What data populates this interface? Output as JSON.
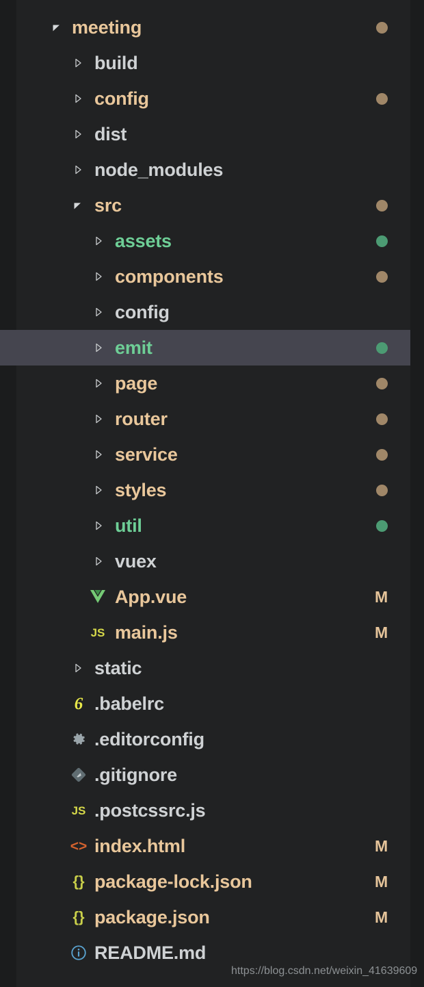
{
  "explorer": {
    "watermark": "https://blog.csdn.net/weixin_41639609",
    "colors": {
      "background": "#212223",
      "selected_row": "#45454f",
      "text_modified": "#e9c79b",
      "text_untracked": "#6ece96",
      "text_default": "#cfd2d4",
      "dot_modified": "#a08768",
      "dot_untracked": "#4c9b73"
    },
    "rows": [
      {
        "label": "meeting",
        "indent": 0,
        "type": "folder",
        "state": "expanded",
        "color": "tan",
        "badge": "dot-tan",
        "icon": ""
      },
      {
        "label": "build",
        "indent": 1,
        "type": "folder",
        "state": "collapsed",
        "color": "gray",
        "badge": "",
        "icon": ""
      },
      {
        "label": "config",
        "indent": 1,
        "type": "folder",
        "state": "collapsed",
        "color": "tan",
        "badge": "dot-tan",
        "icon": ""
      },
      {
        "label": "dist",
        "indent": 1,
        "type": "folder",
        "state": "collapsed",
        "color": "gray",
        "badge": "",
        "icon": ""
      },
      {
        "label": "node_modules",
        "indent": 1,
        "type": "folder",
        "state": "collapsed",
        "color": "gray",
        "badge": "",
        "icon": ""
      },
      {
        "label": "src",
        "indent": 1,
        "type": "folder",
        "state": "expanded",
        "color": "tan",
        "badge": "dot-tan",
        "icon": ""
      },
      {
        "label": "assets",
        "indent": 2,
        "type": "folder",
        "state": "collapsed",
        "color": "green",
        "badge": "dot-green",
        "icon": ""
      },
      {
        "label": "components",
        "indent": 2,
        "type": "folder",
        "state": "collapsed",
        "color": "tan",
        "badge": "dot-tan",
        "icon": ""
      },
      {
        "label": "config",
        "indent": 2,
        "type": "folder",
        "state": "collapsed",
        "color": "gray",
        "badge": "",
        "icon": ""
      },
      {
        "label": "emit",
        "indent": 2,
        "type": "folder",
        "state": "collapsed",
        "color": "green",
        "badge": "dot-green",
        "icon": "",
        "selected": true
      },
      {
        "label": "page",
        "indent": 2,
        "type": "folder",
        "state": "collapsed",
        "color": "tan",
        "badge": "dot-tan",
        "icon": ""
      },
      {
        "label": "router",
        "indent": 2,
        "type": "folder",
        "state": "collapsed",
        "color": "tan",
        "badge": "dot-tan",
        "icon": ""
      },
      {
        "label": "service",
        "indent": 2,
        "type": "folder",
        "state": "collapsed",
        "color": "tan",
        "badge": "dot-tan",
        "icon": ""
      },
      {
        "label": "styles",
        "indent": 2,
        "type": "folder",
        "state": "collapsed",
        "color": "tan",
        "badge": "dot-tan",
        "icon": ""
      },
      {
        "label": "util",
        "indent": 2,
        "type": "folder",
        "state": "collapsed",
        "color": "green",
        "badge": "dot-green",
        "icon": ""
      },
      {
        "label": "vuex",
        "indent": 2,
        "type": "folder",
        "state": "collapsed",
        "color": "gray",
        "badge": "",
        "icon": ""
      },
      {
        "label": "App.vue",
        "indent": 2,
        "type": "file",
        "state": "",
        "color": "tan",
        "badge": "M",
        "icon": "vue-icon"
      },
      {
        "label": "main.js",
        "indent": 2,
        "type": "file",
        "state": "",
        "color": "tan",
        "badge": "M",
        "icon": "js-icon"
      },
      {
        "label": "static",
        "indent": 1,
        "type": "folder",
        "state": "collapsed",
        "color": "gray",
        "badge": "",
        "icon": ""
      },
      {
        "label": ".babelrc",
        "indent": 1,
        "type": "file",
        "state": "",
        "color": "gray",
        "badge": "",
        "icon": "babel-icon"
      },
      {
        "label": ".editorconfig",
        "indent": 1,
        "type": "file",
        "state": "",
        "color": "gray",
        "badge": "",
        "icon": "gear-icon"
      },
      {
        "label": ".gitignore",
        "indent": 1,
        "type": "file",
        "state": "",
        "color": "gray",
        "badge": "",
        "icon": "git-icon"
      },
      {
        "label": ".postcssrc.js",
        "indent": 1,
        "type": "file",
        "state": "",
        "color": "gray",
        "badge": "",
        "icon": "js-icon"
      },
      {
        "label": "index.html",
        "indent": 1,
        "type": "file",
        "state": "",
        "color": "tan",
        "badge": "M",
        "icon": "html-icon"
      },
      {
        "label": "package-lock.json",
        "indent": 1,
        "type": "file",
        "state": "",
        "color": "tan",
        "badge": "M",
        "icon": "json-icon"
      },
      {
        "label": "package.json",
        "indent": 1,
        "type": "file",
        "state": "",
        "color": "tan",
        "badge": "M",
        "icon": "json-icon"
      },
      {
        "label": "README.md",
        "indent": 1,
        "type": "file",
        "state": "",
        "color": "gray",
        "badge": "",
        "icon": "info-icon"
      }
    ]
  }
}
